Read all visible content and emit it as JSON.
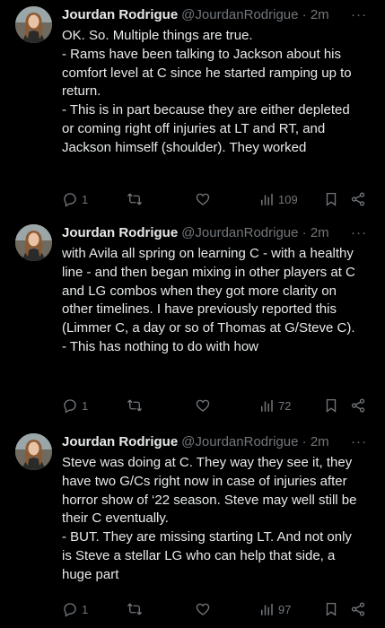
{
  "author": {
    "name": "Jourdan Rodrigue",
    "handle": "@JourdanRodrigue",
    "sep": "·",
    "time": "2m"
  },
  "more_label": "···",
  "tweets": [
    {
      "text": "OK. So. Multiple things are true.\n- Rams have been talking to Jackson about his comfort level at C since he started ramping up to return.\n- This is in part because they are either depleted or coming right off injuries at LT and RT, and Jackson himself (shoulder). They worked",
      "replies": "1",
      "retweets": "",
      "likes": "",
      "views": "109"
    },
    {
      "text": "with Avila all spring on learning C - with a healthy line - and then began mixing in other players at C and LG combos when they got more clarity on other timelines. I have previously reported this (Limmer C, a day or so of Thomas at G/Steve C).\n- This has nothing to do with how",
      "replies": "1",
      "retweets": "",
      "likes": "",
      "views": "72"
    },
    {
      "text": "Steve was doing at C. They way they see it, they have two G/Cs right now in case of injuries after horror show of ‘22 season. Steve may well still be their C eventually.\n- BUT. They are missing starting LT. And not only is Steve a stellar LG who can help that side, a huge part",
      "replies": "1",
      "retweets": "",
      "likes": "",
      "views": "97"
    }
  ],
  "colors": {
    "background": "#000000",
    "text": "#e7e9ea",
    "secondary": "#71767b"
  }
}
